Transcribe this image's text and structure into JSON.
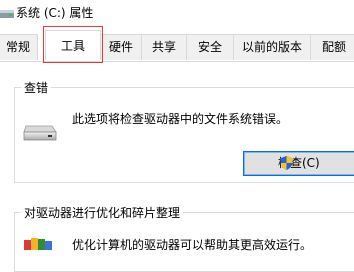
{
  "window": {
    "title": "系统 (C:) 属性"
  },
  "tabs": [
    {
      "label": "常规"
    },
    {
      "label": "工具"
    },
    {
      "label": "硬件"
    },
    {
      "label": "共享"
    },
    {
      "label": "安全"
    },
    {
      "label": "以前的版本"
    },
    {
      "label": "配额"
    }
  ],
  "active_tab": "工具",
  "error_check": {
    "title": "查错",
    "description": "此选项将检查驱动器中的文件系统错误。",
    "button_label": "检查(C)",
    "icon": "drive-icon",
    "button_icon": "uac-shield-icon"
  },
  "optimize": {
    "title": "对驱动器进行优化和碎片整理",
    "description": "优化计算机的驱动器可以帮助其更高效运行。",
    "icon": "defrag-icon"
  },
  "colors": {
    "highlight": "#e23a3a",
    "button_border": "#0a6fd8",
    "tab_bg": "#f0f0f0"
  }
}
